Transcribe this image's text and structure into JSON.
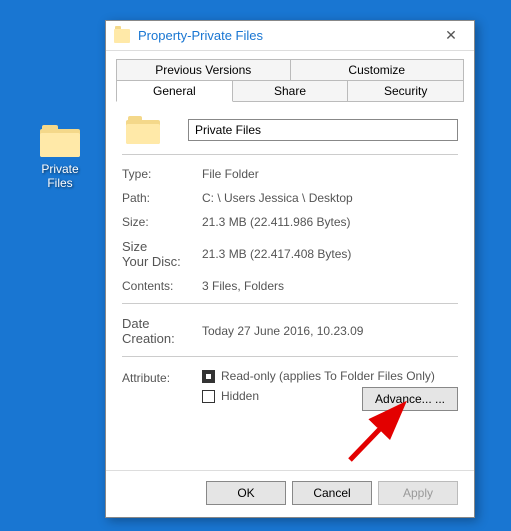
{
  "desktop": {
    "folder_label": "Private Files"
  },
  "dialog": {
    "title": "Property-Private Files",
    "tabs_top": [
      "Previous Versions",
      "Customize"
    ],
    "tabs_bottom": [
      "General",
      "Share",
      "Security"
    ],
    "active_tab": "General",
    "name_value": "Private Files",
    "fields": {
      "type_label": "Type:",
      "type_value": "File Folder",
      "path_label": "Path:",
      "path_value": "C: \\ Users Jessica \\ Desktop",
      "size_label": "Size:",
      "size_value": "21.3 MB (22.411.986 Bytes)",
      "disk_label_line1": "Size",
      "disk_label_line2": "Your Disc:",
      "disk_value": "21.3 MB (22.417.408 Bytes)",
      "contents_label": "Contents:",
      "contents_value": "3 Files, Folders",
      "date_label_line1": "Date",
      "date_label_line2": "Creation:",
      "date_value": "Today 27 June 2016, 10.23.09",
      "attr_label": "Attribute:",
      "readonly_label": "Read-only (applies To Folder Files Only)",
      "hidden_label": "Hidden",
      "advance_label": "Advance... ..."
    },
    "buttons": {
      "ok": "OK",
      "cancel": "Cancel",
      "apply": "Apply"
    }
  }
}
